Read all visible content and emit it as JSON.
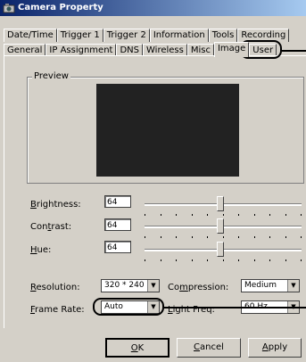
{
  "window": {
    "title": "Camera Property"
  },
  "tabs": {
    "row1": [
      "Date/Time",
      "Trigger 1",
      "Trigger 2",
      "Information",
      "Tools",
      "Recording"
    ],
    "row2": [
      "General",
      "IP Assignment",
      "DNS",
      "Wireless",
      "Misc",
      "Image",
      "User"
    ],
    "active": "Image"
  },
  "preview": {
    "label": "Preview"
  },
  "sliders": [
    {
      "key": "B",
      "rest": "rightness:",
      "value": "64",
      "level": 0.5
    },
    {
      "key": "t",
      "pre": "Con",
      "rest": "rast:",
      "value": "64",
      "level": 0.5
    },
    {
      "key": "H",
      "rest": "ue:",
      "value": "64",
      "level": 0.5
    }
  ],
  "settings": {
    "resolution_key": "R",
    "resolution_rest": "esolution:",
    "resolution_value": "320 * 240",
    "compression_pre": "Co",
    "compression_key": "m",
    "compression_rest": "pression:",
    "compression_value": "Medium",
    "framerate_key": "F",
    "framerate_rest": "rame Rate:",
    "framerate_value": "Auto",
    "lightfreq_key": "L",
    "lightfreq_rest": "ight Freq:",
    "lightfreq_value": "60 Hz"
  },
  "buttons": {
    "ok_key": "O",
    "ok_rest": "K",
    "cancel_key": "C",
    "cancel_rest": "ancel",
    "apply_key": "A",
    "apply_rest": "pply"
  },
  "colors": {
    "titlebar_start": "#0a246a",
    "titlebar_end": "#a6caf0",
    "face": "#d4d0c8",
    "preview": "#222222"
  }
}
